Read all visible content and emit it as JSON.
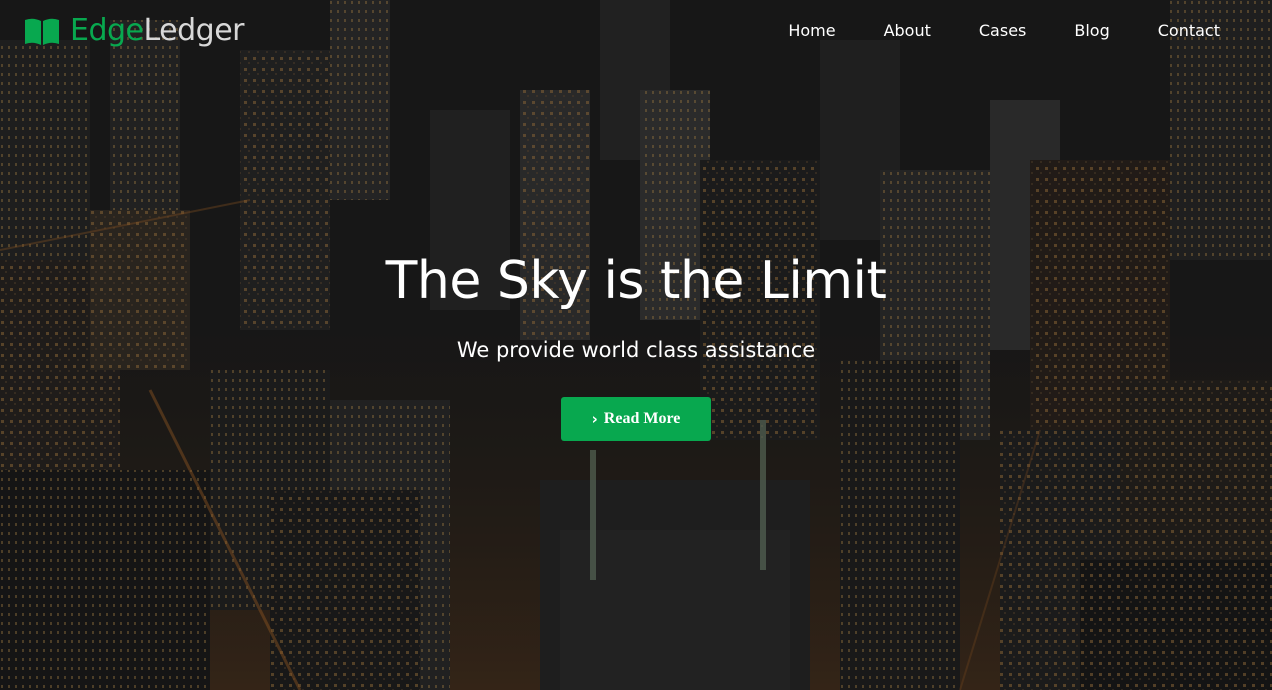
{
  "brand": {
    "name_part1": "Edge",
    "name_part2": "Ledger",
    "icon": "open-book-icon",
    "colors": {
      "accent": "#08a84f",
      "secondary": "#d8d8d8"
    }
  },
  "nav": {
    "items": [
      {
        "label": "Home"
      },
      {
        "label": "About"
      },
      {
        "label": "Cases"
      },
      {
        "label": "Blog"
      },
      {
        "label": "Contact"
      }
    ]
  },
  "hero": {
    "title": "The Sky is the Limit",
    "subtitle": "We provide world class assistance",
    "button": {
      "label": "Read More",
      "icon": "chevron-right-icon",
      "color": "#08a84f"
    },
    "background": "aerial-city-night-image"
  }
}
